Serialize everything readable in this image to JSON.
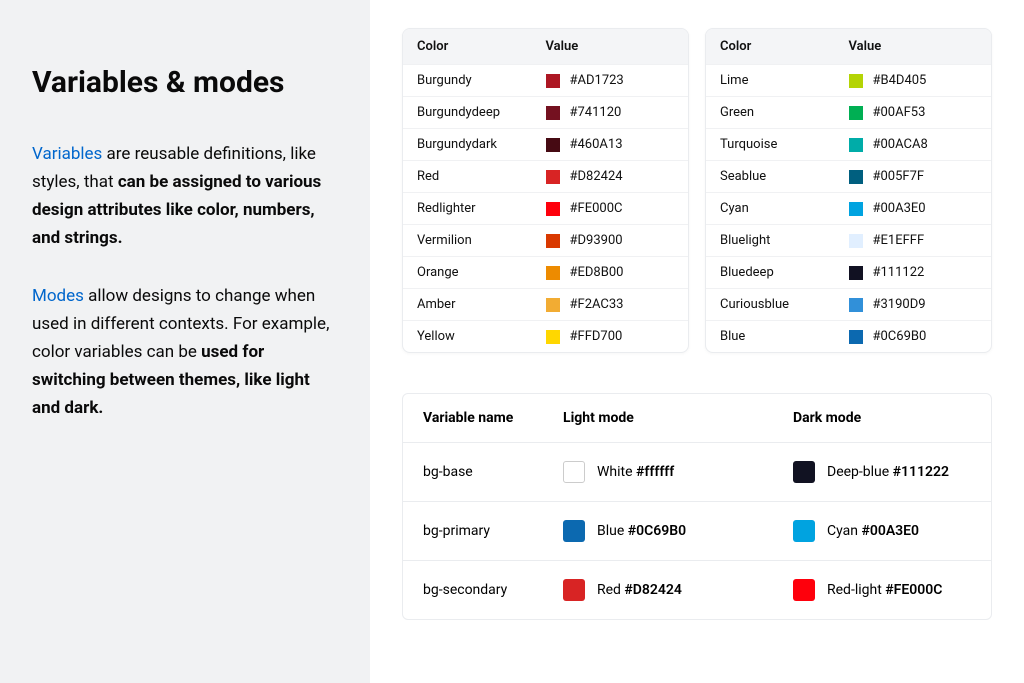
{
  "sidebar": {
    "title": "Variables & modes",
    "p1_link": "Variables",
    "p1_text1": " are reusable definitions, like styles, that ",
    "p1_bold": "can be assigned to various design attributes like color, numbers, and strings.",
    "p2_link": "Modes",
    "p2_text1": " allow designs to change when used in different contexts. For example, color variables can be ",
    "p2_bold": "used for switching between themes, like light and dark."
  },
  "colorTableHeaders": {
    "color": "Color",
    "value": "Value"
  },
  "colorTable1": [
    {
      "name": "Burgundy",
      "hex": "#AD1723"
    },
    {
      "name": "Burgundydeep",
      "hex": "#741120"
    },
    {
      "name": "Burgundydark",
      "hex": "#460A13"
    },
    {
      "name": "Red",
      "hex": "#D82424"
    },
    {
      "name": "Redlighter",
      "hex": "#FE000C"
    },
    {
      "name": "Vermilion",
      "hex": "#D93900"
    },
    {
      "name": "Orange",
      "hex": "#ED8B00"
    },
    {
      "name": "Amber",
      "hex": "#F2AC33"
    },
    {
      "name": "Yellow",
      "hex": "#FFD700"
    }
  ],
  "colorTable2": [
    {
      "name": "Lime",
      "hex": "#B4D405"
    },
    {
      "name": "Green",
      "hex": "#00AF53"
    },
    {
      "name": "Turquoise",
      "hex": "#00ACA8"
    },
    {
      "name": "Seablue",
      "hex": "#005F7F"
    },
    {
      "name": "Cyan",
      "hex": "#00A3E0"
    },
    {
      "name": "Bluelight",
      "hex": "#E1EFFF"
    },
    {
      "name": "Bluedeep",
      "hex": "#111122"
    },
    {
      "name": "Curiousblue",
      "hex": "#3190D9"
    },
    {
      "name": "Blue",
      "hex": "#0C69B0"
    }
  ],
  "modesTable": {
    "headers": {
      "variable": "Variable name",
      "light": "Light mode",
      "dark": "Dark mode"
    },
    "rows": [
      {
        "name": "bg-base",
        "light": {
          "label": "White",
          "hex": "#ffffff",
          "swatch": "#ffffff",
          "bordered": true
        },
        "dark": {
          "label": "Deep-blue",
          "hex": "#111222",
          "swatch": "#111222"
        }
      },
      {
        "name": "bg-primary",
        "light": {
          "label": "Blue",
          "hex": "#0C69B0",
          "swatch": "#0C69B0"
        },
        "dark": {
          "label": "Cyan",
          "hex": "#00A3E0",
          "swatch": "#00A3E0"
        }
      },
      {
        "name": "bg-secondary",
        "light": {
          "label": "Red",
          "hex": "#D82424",
          "swatch": "#D82424"
        },
        "dark": {
          "label": "Red-light",
          "hex": "#FE000C",
          "swatch": "#FE000C"
        }
      }
    ]
  }
}
